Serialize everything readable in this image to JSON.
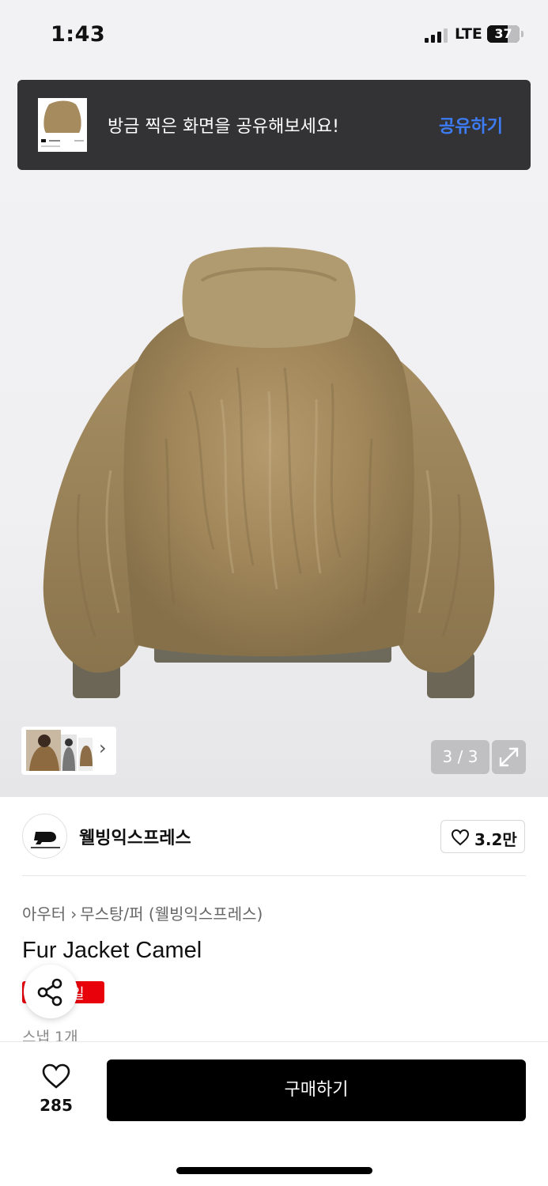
{
  "status_bar": {
    "time": "1:43",
    "network": "LTE",
    "battery": "37",
    "signal_bars_filled": 3,
    "signal_bars_total": 4,
    "battery_level_fraction": 0.37
  },
  "toast": {
    "message": "방금 찍은 화면을 공유해보세요!",
    "action_label": "공유하기"
  },
  "gallery": {
    "counter": "3 / 3",
    "current": 3,
    "total": 3
  },
  "brand": {
    "name": "웰빙익스프레스",
    "like_count": "3.2만"
  },
  "breadcrumb": {
    "category": "아우터",
    "subcategory": "무스탕/퍼 (웰빙익스프레스)"
  },
  "product": {
    "title": "Fur Jacket Camel",
    "badge": "세일",
    "badge_visible": "일",
    "snap_count": "스냅 1개"
  },
  "bottom_bar": {
    "wish_count": "285",
    "buy_label": "구매하기"
  },
  "colors": {
    "accent_blue": "#3d7cf5",
    "sale_red": "#e8000b",
    "toast_bg": "#333335",
    "buy_bg": "#000000"
  }
}
